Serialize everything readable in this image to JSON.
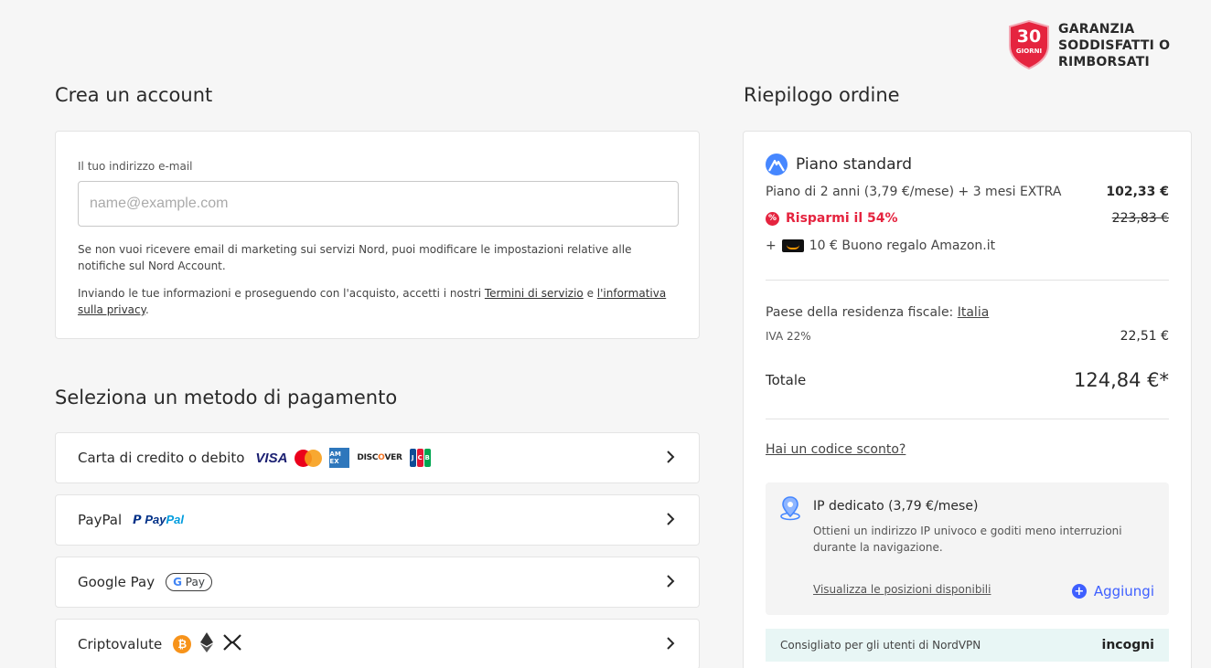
{
  "guarantee": {
    "number": "30",
    "unit": "GIORNI",
    "text": "GARANZIA SODDISFATTI O RIMBORSATI",
    "badge_color": "#e5243f"
  },
  "account": {
    "heading": "Crea un account",
    "email_label": "Il tuo indirizzo e-mail",
    "email_placeholder": "name@example.com",
    "email_value": "",
    "marketing_note": "Se non vuoi ricevere email di marketing sui servizi Nord, puoi modificare le impostazioni relative alle notifiche sul Nord Account.",
    "terms_prefix": "Inviando le tue informazioni e proseguendo con l'acquisto, accetti i nostri ",
    "terms_link": "Termini di servizio",
    "terms_and": " e ",
    "privacy_link": "l'informativa sulla privacy",
    "terms_suffix": "."
  },
  "payment": {
    "heading": "Seleziona un metodo di pagamento",
    "methods": [
      {
        "label": "Carta di credito o debito",
        "logos": [
          "visa",
          "mastercard",
          "amex",
          "discover",
          "jcb"
        ]
      },
      {
        "label": "PayPal",
        "logos": [
          "paypal"
        ]
      },
      {
        "label": "Google Pay",
        "logos": [
          "google-pay"
        ]
      },
      {
        "label": "Criptovalute",
        "logos": [
          "bitcoin",
          "ethereum",
          "ripple"
        ]
      }
    ],
    "logo_text": {
      "visa": "VISA",
      "amex": "AM EX",
      "discover_a": "DISC",
      "discover_o": "O",
      "discover_b": "VER",
      "jcb": [
        "J",
        "C",
        "B"
      ],
      "paypal_a": "Pay",
      "paypal_b": "Pal",
      "gpay_g": "G",
      "gpay_text": " Pay",
      "btc": "₿"
    }
  },
  "summary": {
    "heading": "Riepilogo ordine",
    "plan_title": "Piano standard",
    "plan_desc": "Piano di 2 anni (3,79 €/mese) + 3 mesi EXTRA",
    "plan_price": "102,33 €",
    "savings_label": "Risparmi il 54%",
    "savings_icon": "%",
    "original_price": "223,83 €",
    "gift_prefix": "+",
    "gift_text": "10 € Buono regalo Amazon.it",
    "tax_country_label": "Paese della residenza fiscale: ",
    "tax_country": "Italia",
    "vat_label": "IVA 22%",
    "vat_amount": "22,51 €",
    "total_label": "Totale",
    "total_amount": "124,84 €*",
    "discount_link": "Hai un codice sconto?",
    "dedicated_ip": {
      "title": "IP dedicato (3,79 €/mese)",
      "description": "Ottieni un indirizzo IP univoco e goditi meno interruzioni durante la navigazione.",
      "link": "Visualizza le posizioni disponibili",
      "add": "Aggiungi"
    },
    "incogni": {
      "text": "Consigliato per gli utenti di NordVPN",
      "logo": "incogni"
    }
  }
}
